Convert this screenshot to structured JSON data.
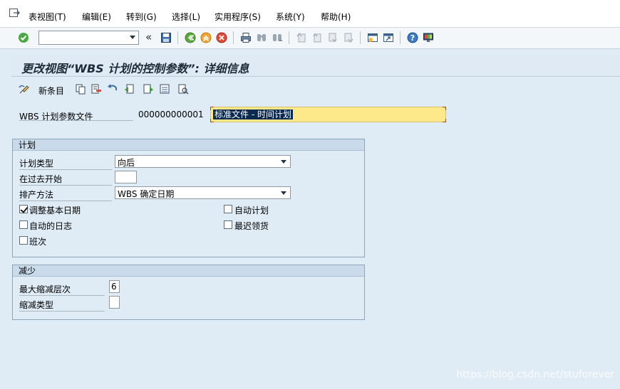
{
  "menu": {
    "items": [
      "表视图(T)",
      "编辑(E)",
      "转到(G)",
      "选择(L)",
      "实用程序(S)",
      "系统(Y)",
      "帮助(H)"
    ]
  },
  "toolbar": {
    "command_value": "",
    "icons": [
      "enter-icon",
      "back-icon",
      "exit-icon",
      "cancel-icon",
      "print-icon",
      "find-icon",
      "find-next-icon",
      "first-page-icon",
      "previous-page-icon",
      "next-page-icon",
      "last-page-icon",
      "create-session-icon",
      "shortcut-icon",
      "help-icon",
      "customize-layout-icon"
    ]
  },
  "title": "更改视图“WBS 计划的控制参数”: 详细信息",
  "app_toolbar": {
    "new_entries_label": "新条目"
  },
  "header": {
    "label": "WBS 计划参数文件",
    "key": "000000000001",
    "text_value": "标准文件 - 时间计划"
  },
  "planning": {
    "group_title": "计划",
    "plan_type_label": "计划类型",
    "plan_type_value": "向后",
    "start_in_past_label": "在过去开始",
    "start_in_past_value": "",
    "scheduling_method_label": "排产方法",
    "scheduling_method_value": "WBS 确定日期",
    "adjust_basic_dates_label": "调整基本日期",
    "adjust_basic_dates_checked": true,
    "auto_schedule_label": "自动计划",
    "auto_schedule_checked": false,
    "auto_log_label": "自动的日志",
    "auto_log_checked": false,
    "latest_staging_label": "最迟领货",
    "latest_staging_checked": false,
    "shift_label": "班次",
    "shift_checked": false
  },
  "reduction": {
    "group_title": "减少",
    "max_reduction_level_label": "最大缩减层次",
    "max_reduction_level_value": "6",
    "reduction_type_label": "缩减类型",
    "reduction_type_value": ""
  },
  "watermark": "https://blog.csdn.net/stuforever"
}
